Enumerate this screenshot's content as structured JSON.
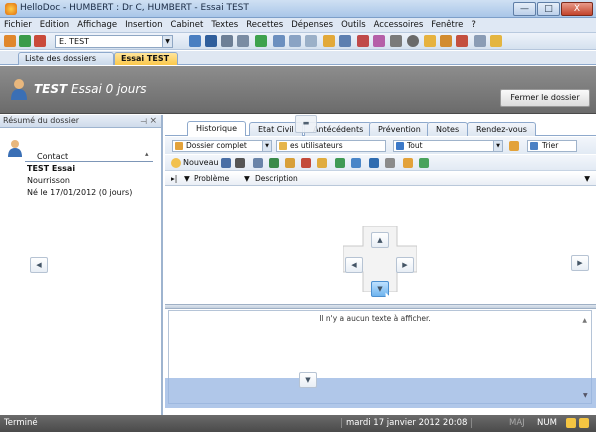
{
  "window": {
    "title": "HelloDoc - HUMBERT : Dr C, HUMBERT - Essai TEST",
    "min_label": "—",
    "max_label": "□",
    "close_label": "X"
  },
  "menu": [
    "Fichier",
    "Edition",
    "Affichage",
    "Insertion",
    "Cabinet",
    "Textes",
    "Recettes",
    "Dépenses",
    "Outils",
    "Accessoires",
    "Fenêtre",
    "?"
  ],
  "toolbar": {
    "patient_value": "E. TEST"
  },
  "doc_tabs": [
    "Liste des dossiers",
    "Essai TEST"
  ],
  "doc_tab_close": "×",
  "banner": {
    "name": "TEST",
    "subtitle": "Essai 0 jours",
    "close_button": "Fermer le dossier"
  },
  "left_panel": {
    "header": "Résumé du dossier",
    "pin": "⊣",
    "close": "×",
    "section": "Contact",
    "collapse": "▴",
    "patient_name": "TEST Essai",
    "category": "Nourrisson",
    "birth": "Né le 17/01/2012 (0 jours)"
  },
  "tabs": [
    "Historique",
    "Etat Civil",
    "Antécédents",
    "Prévention",
    "Notes",
    "Rendez-vous"
  ],
  "filters": {
    "dossier": "Dossier complet",
    "users": "es utilisateurs",
    "scope": "Tout",
    "sort": "Trier"
  },
  "actions": {
    "new": "Nouveau"
  },
  "columns": [
    "Problème",
    "Description"
  ],
  "notes": {
    "empty": "Il n'y a aucun texte à afficher."
  },
  "statusbar": {
    "status": "Terminé",
    "date": "mardi 17 janvier 2012  20:08",
    "maj": "MAJ",
    "num": "NUM"
  },
  "colors": {
    "title_bar": "#a9c6e8",
    "active_tab": "#fbc84a",
    "banner": "#7a7a7a",
    "status_bar": "#4a4a4a",
    "dock_highlight": "#96b4e1"
  }
}
